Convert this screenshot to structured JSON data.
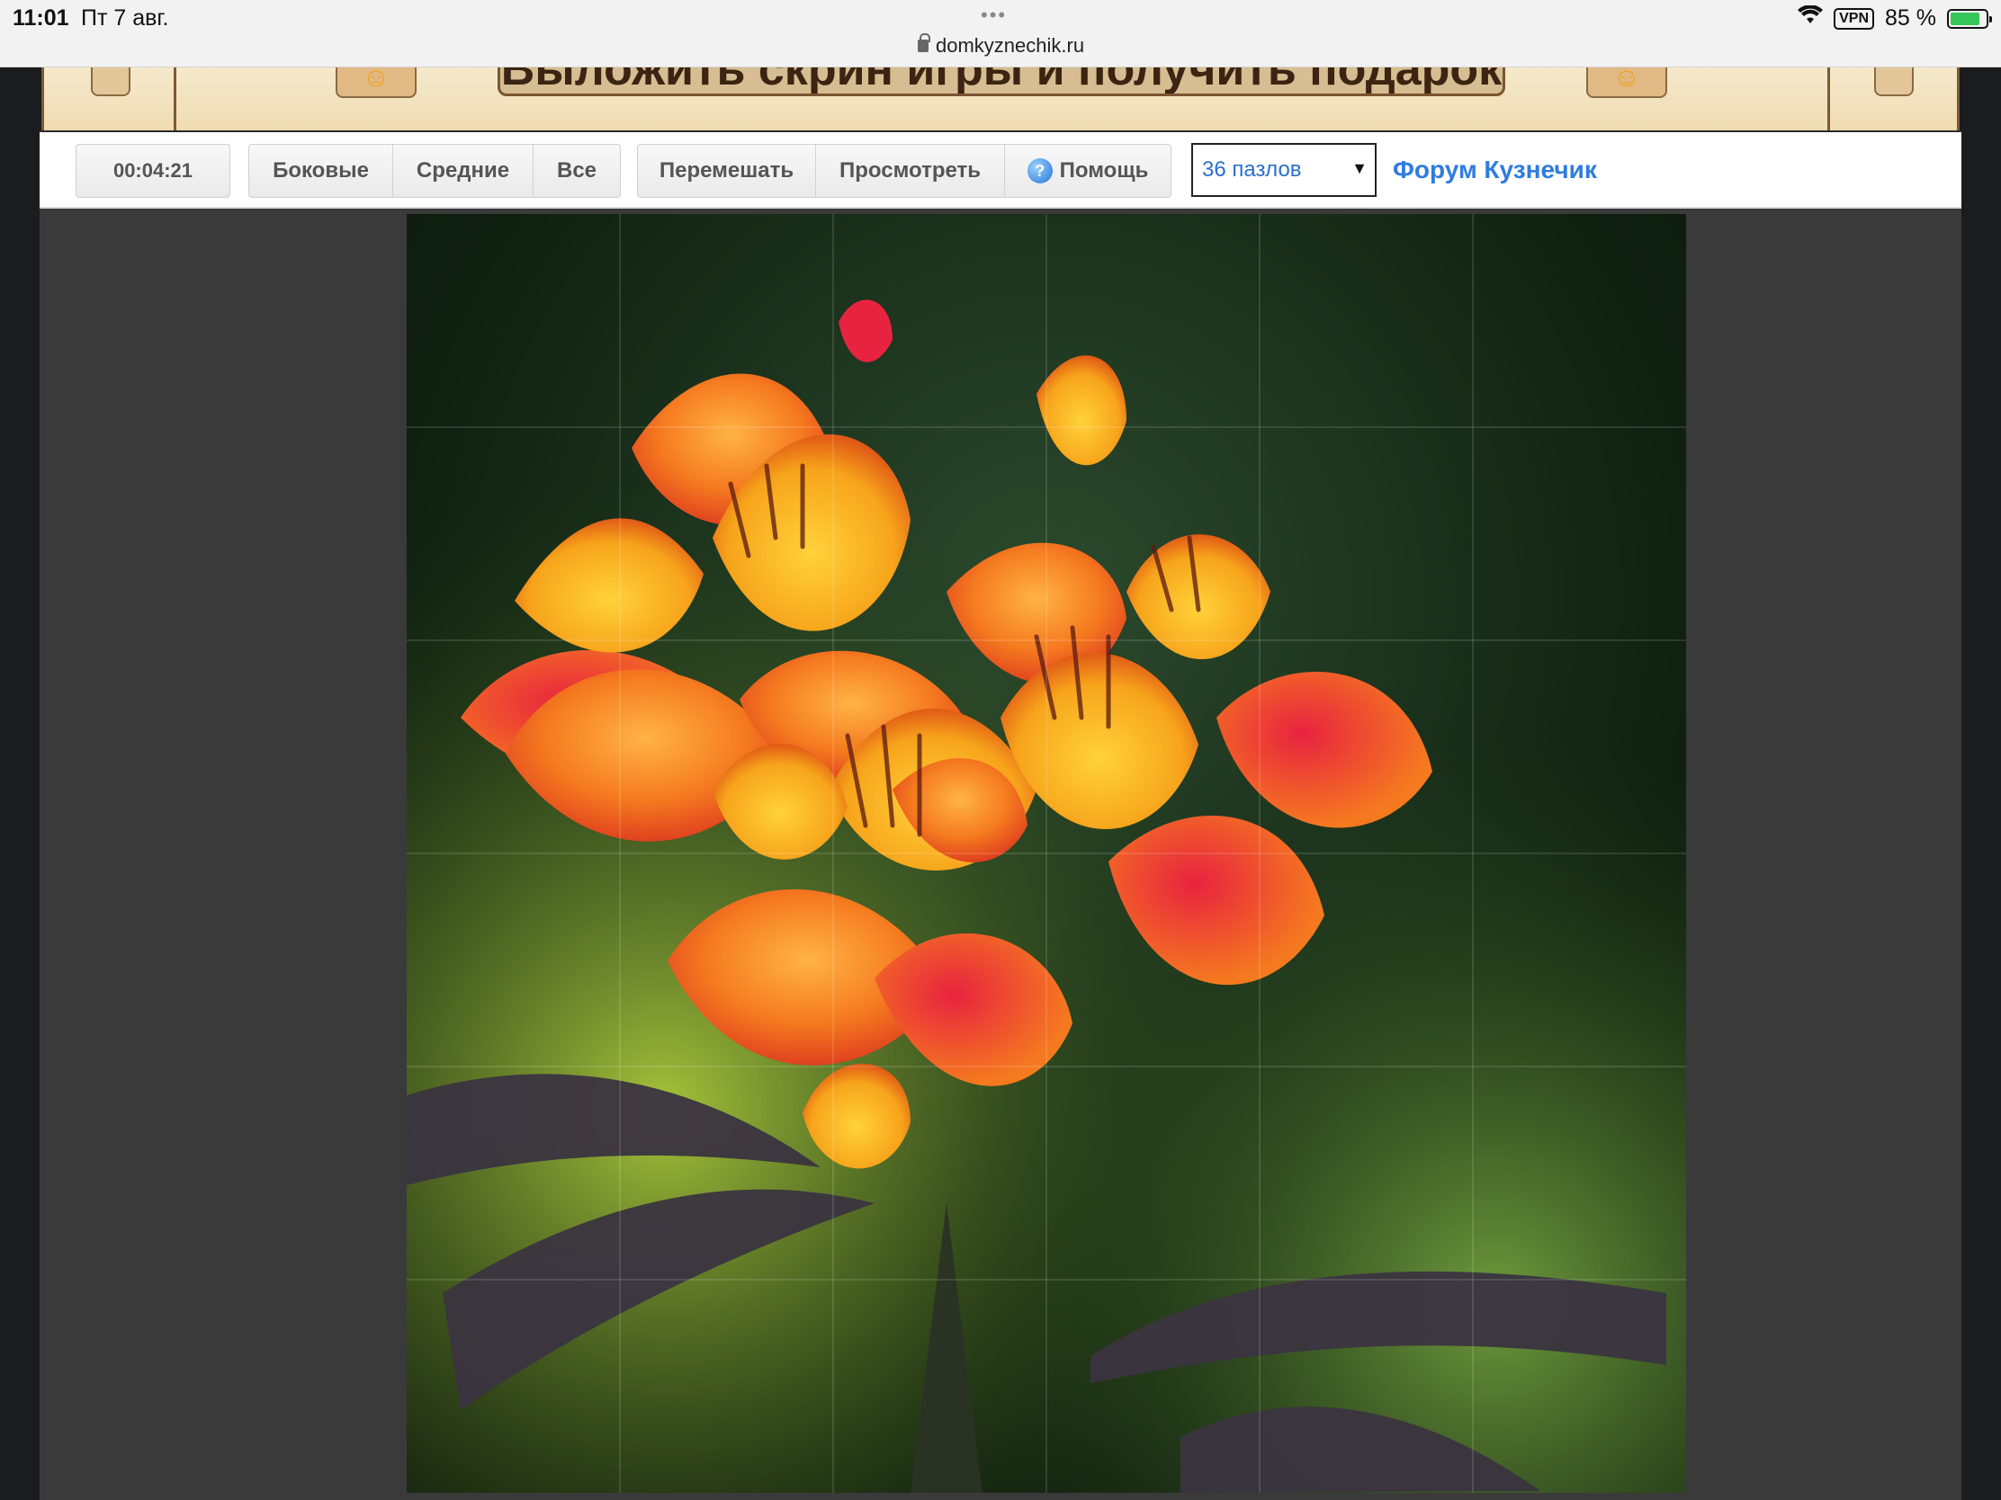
{
  "status_bar": {
    "time": "11:01",
    "date": "Пт 7 авг.",
    "tab_dots": "•••",
    "url": "domkyznechik.ru",
    "vpn": "VPN",
    "battery": "85 %"
  },
  "banner": {
    "text": "Выложить скрин игры и получить подарок"
  },
  "toolbar": {
    "timer": "00:04:21",
    "edge_button": "Боковые",
    "middle_button": "Средние",
    "all_button": "Все",
    "shuffle_button": "Перемешать",
    "preview_button": "Просмотреть",
    "help_button": "Помощь",
    "pieces_select": "36 пазлов",
    "forum_link": "Форум Кузнечик"
  },
  "puzzle": {
    "pieces": 36,
    "rows": 6,
    "cols": 6
  },
  "colors": {
    "link": "#2f7ce0",
    "banner_bg": "#f5e9cc",
    "play_bg": "#3a3a3a"
  }
}
